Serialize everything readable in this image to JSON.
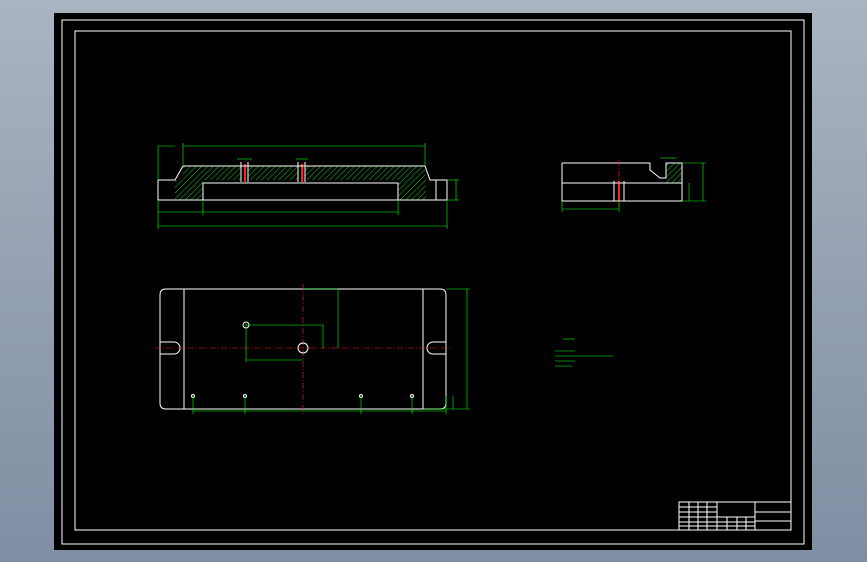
{
  "window": {
    "title": ""
  },
  "drawing": {
    "notes_title": "",
    "notes": [],
    "title_block": {
      "name": "",
      "number": ""
    }
  },
  "colors": {
    "canvas": "#000000",
    "geometry": "#ffffff",
    "dimensions": "#00ff00",
    "centerlines": "#ff2020",
    "hatch": "#00ff00"
  }
}
